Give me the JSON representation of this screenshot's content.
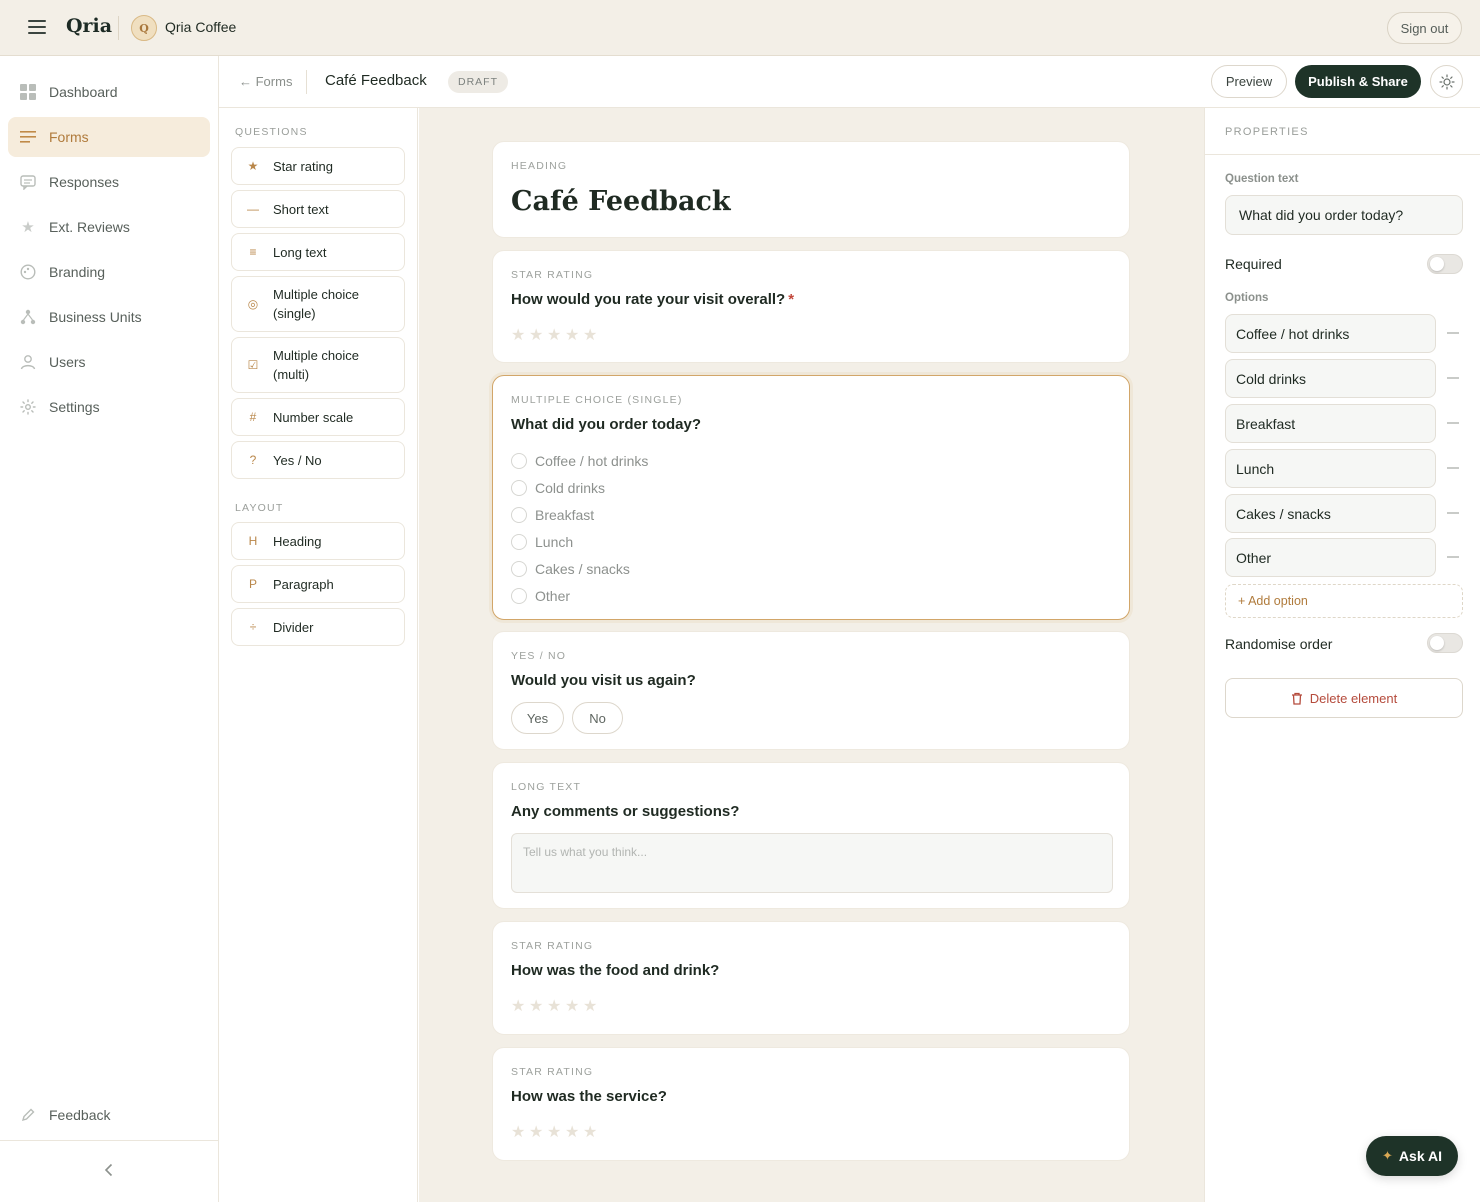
{
  "app": {
    "logo": "Qria",
    "org_initial": "Q",
    "org_name": "Qria Coffee",
    "sign_out": "Sign out"
  },
  "sidebar": {
    "items": [
      {
        "label": "Dashboard",
        "icon": "grid-icon"
      },
      {
        "label": "Forms",
        "icon": "list-icon",
        "active": true
      },
      {
        "label": "Responses",
        "icon": "chat-icon"
      },
      {
        "label": "Ext. Reviews",
        "icon": "star-icon"
      },
      {
        "label": "Branding",
        "icon": "palette-icon"
      },
      {
        "label": "Business Units",
        "icon": "units-icon"
      },
      {
        "label": "Users",
        "icon": "user-icon"
      },
      {
        "label": "Settings",
        "icon": "gear-icon"
      }
    ],
    "feedback": "Feedback"
  },
  "header": {
    "back": "← Forms",
    "title": "Café Feedback",
    "status": "DRAFT",
    "preview": "Preview",
    "publish": "Publish & Share"
  },
  "palette": {
    "questions_label": "QUESTIONS",
    "questions": [
      {
        "icon": "★",
        "label": "Star rating"
      },
      {
        "icon": "—",
        "label": "Short text"
      },
      {
        "icon": "≡",
        "label": "Long text"
      },
      {
        "icon": "◎",
        "label": "Multiple choice (single)"
      },
      {
        "icon": "☑",
        "label": "Multiple choice (multi)"
      },
      {
        "icon": "#",
        "label": "Number scale"
      },
      {
        "icon": "?",
        "label": "Yes / No"
      }
    ],
    "layout_label": "LAYOUT",
    "layout": [
      {
        "icon": "H",
        "label": "Heading"
      },
      {
        "icon": "P",
        "label": "Paragraph"
      },
      {
        "icon": "÷",
        "label": "Divider"
      }
    ]
  },
  "canvas": {
    "heading": {
      "type": "HEADING",
      "text": "Café Feedback"
    },
    "q1": {
      "type": "STAR RATING",
      "question": "How would you rate your visit overall?",
      "required_mark": "*"
    },
    "q2": {
      "type": "MULTIPLE CHOICE (SINGLE)",
      "question": "What did you order today?",
      "options": [
        "Coffee / hot drinks",
        "Cold drinks",
        "Breakfast",
        "Lunch",
        "Cakes / snacks",
        "Other"
      ]
    },
    "q3": {
      "type": "YES / NO",
      "question": "Would you visit us again?",
      "yes": "Yes",
      "no": "No"
    },
    "q4": {
      "type": "LONG TEXT",
      "question": "Any comments or suggestions?",
      "placeholder": "Tell us what you think..."
    },
    "q5": {
      "type": "STAR RATING",
      "question": "How was the food and drink?"
    },
    "q6": {
      "type": "STAR RATING",
      "question": "How was the service?"
    }
  },
  "properties": {
    "title": "PROPERTIES",
    "question_text_label": "Question text",
    "question_text": "What did you order today?",
    "required_label": "Required",
    "required": false,
    "options_label": "Options",
    "options": [
      "Coffee / hot drinks",
      "Cold drinks",
      "Breakfast",
      "Lunch",
      "Cakes / snacks",
      "Other"
    ],
    "add_option": "+ Add option",
    "randomise_label": "Randomise order",
    "randomise": false,
    "delete": "Delete element"
  },
  "ask_ai": "Ask AI",
  "colors": {
    "accent": "#b07b3c",
    "primary": "#1e3328",
    "canvas_bg": "#f3efe7",
    "selected_border": "#d2a669"
  }
}
